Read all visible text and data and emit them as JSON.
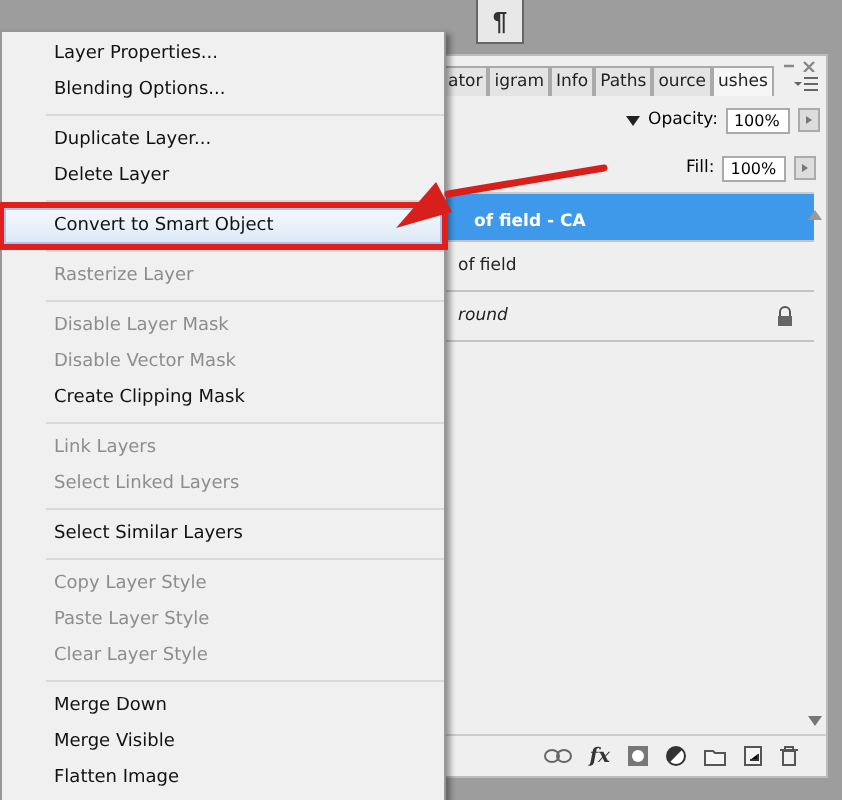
{
  "para_button": {
    "label": "¶"
  },
  "layers_panel": {
    "tabs": [
      {
        "label": "ator",
        "selected": false
      },
      {
        "label": "igram",
        "selected": false
      },
      {
        "label": "Info",
        "selected": false
      },
      {
        "label": "Paths",
        "selected": false
      },
      {
        "label": "ource",
        "selected": false
      },
      {
        "label": "ushes",
        "selected": true
      }
    ],
    "opacity": {
      "label": "Opacity:",
      "value": "100%"
    },
    "fill": {
      "label": "Fill:",
      "value": "100%"
    },
    "layers": [
      {
        "name": "of field - CA",
        "kind": "layer",
        "selected": true,
        "locked": false
      },
      {
        "name": "of field",
        "kind": "layer",
        "selected": false,
        "locked": false
      },
      {
        "name": "round",
        "kind": "background",
        "selected": false,
        "locked": true
      }
    ],
    "fx_button": {
      "label": "fx"
    }
  },
  "context_menu": {
    "groups": [
      [
        {
          "label": "Layer Properties...",
          "disabled": false,
          "highlighted": false
        },
        {
          "label": "Blending Options...",
          "disabled": false,
          "highlighted": false
        }
      ],
      [
        {
          "label": "Duplicate Layer...",
          "disabled": false,
          "highlighted": false
        },
        {
          "label": "Delete Layer",
          "disabled": false,
          "highlighted": false
        }
      ],
      [
        {
          "label": "Convert to Smart Object",
          "disabled": false,
          "highlighted": true
        }
      ],
      [
        {
          "label": "Rasterize Layer",
          "disabled": true,
          "highlighted": false
        }
      ],
      [
        {
          "label": "Disable Layer Mask",
          "disabled": true,
          "highlighted": false
        },
        {
          "label": "Disable Vector Mask",
          "disabled": true,
          "highlighted": false
        },
        {
          "label": "Create Clipping Mask",
          "disabled": false,
          "highlighted": false
        }
      ],
      [
        {
          "label": "Link Layers",
          "disabled": true,
          "highlighted": false
        },
        {
          "label": "Select Linked Layers",
          "disabled": true,
          "highlighted": false
        }
      ],
      [
        {
          "label": "Select Similar Layers",
          "disabled": false,
          "highlighted": false
        }
      ],
      [
        {
          "label": "Copy Layer Style",
          "disabled": true,
          "highlighted": false
        },
        {
          "label": "Paste Layer Style",
          "disabled": true,
          "highlighted": false
        },
        {
          "label": "Clear Layer Style",
          "disabled": true,
          "highlighted": false
        }
      ],
      [
        {
          "label": "Merge Down",
          "disabled": false,
          "highlighted": false
        },
        {
          "label": "Merge Visible",
          "disabled": false,
          "highlighted": false
        },
        {
          "label": "Flatten Image",
          "disabled": false,
          "highlighted": false
        }
      ]
    ]
  }
}
